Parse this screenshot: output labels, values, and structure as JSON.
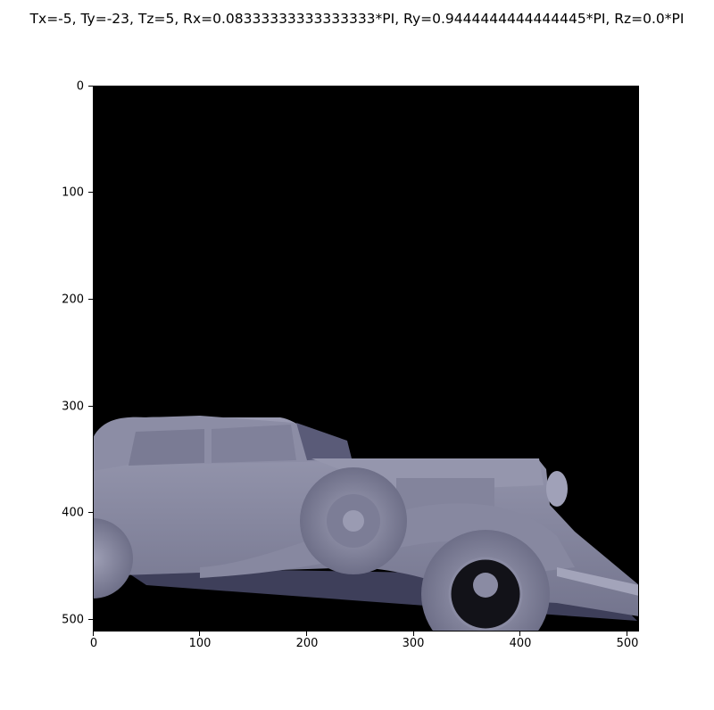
{
  "figure": {
    "title": "Tx=-5, Ty=-23, Tz=5, Rx=0.08333333333333333*PI, Ry=0.9444444444444445*PI, Rz=0.0*PI"
  },
  "image": {
    "subject": "rendered 3D model of a vintage convertible car, side-rear three-quarter view, grey-blue shading on black background",
    "background_color": "#000000",
    "car_color": "#8a8ba3"
  },
  "axes": {
    "x_ticks": [
      "0",
      "100",
      "200",
      "300",
      "400",
      "500"
    ],
    "y_ticks": [
      "0",
      "100",
      "200",
      "300",
      "400",
      "500"
    ],
    "x_range": [
      0,
      512
    ],
    "y_range": [
      0,
      512
    ]
  }
}
